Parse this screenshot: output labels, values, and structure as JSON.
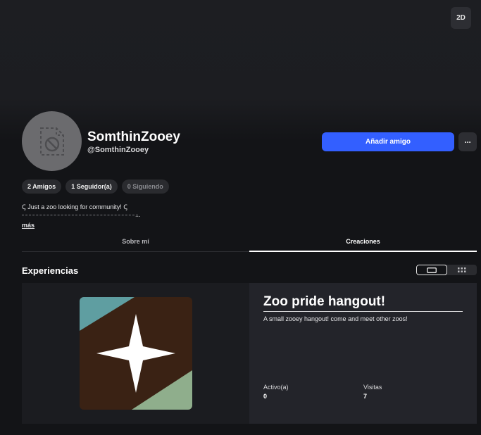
{
  "header": {
    "view_mode_label": "2D"
  },
  "profile": {
    "display_name": "SomthinZooey",
    "username": "@SomthinZooey",
    "add_friend_label": "Añadir amigo",
    "more_options_label": "···",
    "stats": [
      {
        "label": "2 Amigos"
      },
      {
        "label": "1 Seguidor(a)"
      },
      {
        "label": "0 Siguiendo"
      }
    ],
    "bio": "Ꞔ Just a zoo looking for community! Ꞔ",
    "bio_ellipsis": "...",
    "more_link": "más"
  },
  "tabs": [
    {
      "label": "Sobre mí",
      "active": false
    },
    {
      "label": "Creaciones",
      "active": true
    }
  ],
  "experiences": {
    "section_title": "Experiencias",
    "game": {
      "title": "Zoo pride hangout!",
      "description": "A small zooey hangout! come and meet other zoos!",
      "active_label": "Activo(a)",
      "active_value": "0",
      "visits_label": "Visitas",
      "visits_value": "7",
      "thumbnail_colors": {
        "top_left": "#5f9ea1",
        "center": "#3a2214",
        "bottom_right": "#8fae8c",
        "star": "#ffffff"
      }
    }
  },
  "colors": {
    "accent": "#335fff",
    "background": "#131417"
  }
}
